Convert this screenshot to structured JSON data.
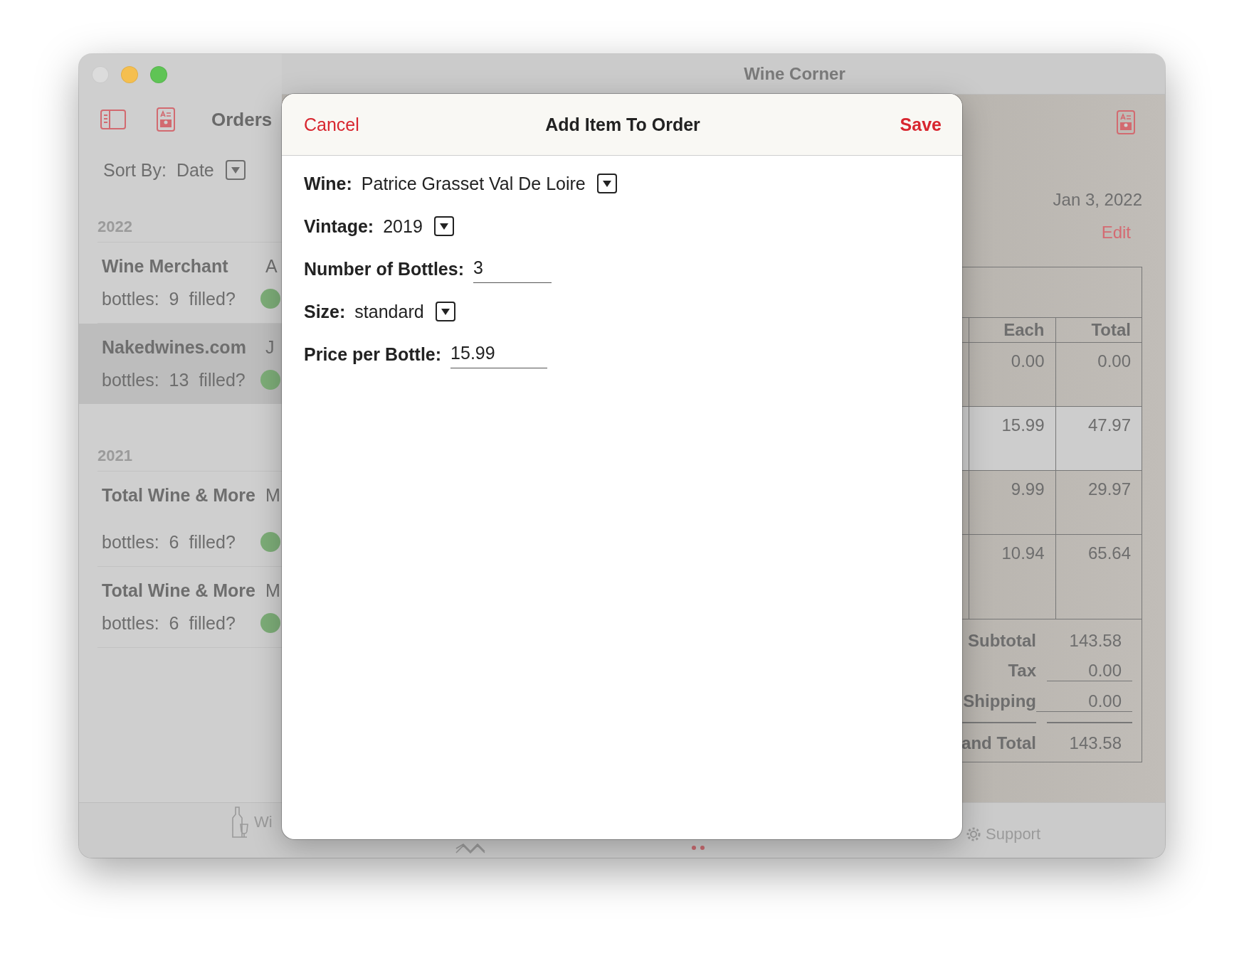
{
  "window": {
    "title": "Wine Corner"
  },
  "toolbar": {
    "title": "Orders"
  },
  "sort": {
    "label": "Sort By:",
    "value": "Date"
  },
  "order_groups": [
    {
      "year": "2022",
      "orders": [
        {
          "name": "Wine Merchant",
          "date": "A",
          "bottles_label": "bottles:",
          "bottles": "9",
          "filled_label": "filled?",
          "filled": true,
          "selected": false
        },
        {
          "name": "Nakedwines.com",
          "date": "J",
          "bottles_label": "bottles:",
          "bottles": "13",
          "filled_label": "filled?",
          "filled": true,
          "selected": true
        }
      ]
    },
    {
      "year": "2021",
      "orders": [
        {
          "name": "Total Wine & More",
          "date": "M",
          "bottles_label": "bottles:",
          "bottles": "6",
          "filled_label": "filled?",
          "filled": true,
          "selected": false
        },
        {
          "name": "Total Wine & More",
          "date": "M",
          "bottles_label": "bottles:",
          "bottles": "6",
          "filled_label": "filled?",
          "filled": true,
          "selected": false
        }
      ]
    }
  ],
  "detail": {
    "date": "Jan 3, 2022",
    "edit": "Edit",
    "table": {
      "columns": [
        "Each",
        "Total"
      ],
      "rows": [
        {
          "cells": [
            "0.00",
            "0.00"
          ],
          "selected": false
        },
        {
          "cells": [
            "15.99",
            "47.97"
          ],
          "selected": true
        },
        {
          "cells": [
            "9.99",
            "29.97"
          ],
          "selected": false
        },
        {
          "cells": [
            "10.94",
            "65.64"
          ],
          "selected": false
        }
      ]
    },
    "summary": [
      {
        "kind": "computed",
        "label": "Subtotal",
        "value": "143.58"
      },
      {
        "kind": "input",
        "label": "Tax",
        "value": "0.00"
      },
      {
        "kind": "input",
        "label": "Shipping",
        "value": "0.00"
      },
      {
        "kind": "grand",
        "label": "and Total",
        "value": "143.58"
      }
    ]
  },
  "tab_bar": {
    "items": [
      {
        "kind": "bottle",
        "label": "Wi"
      },
      {
        "kind": "zigzag"
      },
      {
        "kind": "dots"
      },
      {
        "kind": "gear",
        "label": "Support"
      }
    ]
  },
  "dialog": {
    "title": "Add Item To Order",
    "cancel": "Cancel",
    "save": "Save",
    "fields": [
      {
        "kind": "dropdown",
        "label": "Wine:",
        "value": "Patrice Grasset Val De Loire"
      },
      {
        "kind": "dropdown",
        "label": "Vintage:",
        "value": "2019"
      },
      {
        "kind": "text",
        "label": "Number of Bottles:",
        "value": "3"
      },
      {
        "kind": "dropdown",
        "label": "Size:",
        "value": "standard"
      },
      {
        "kind": "text",
        "label": "Price per Bottle:",
        "value": "15.99"
      }
    ]
  }
}
